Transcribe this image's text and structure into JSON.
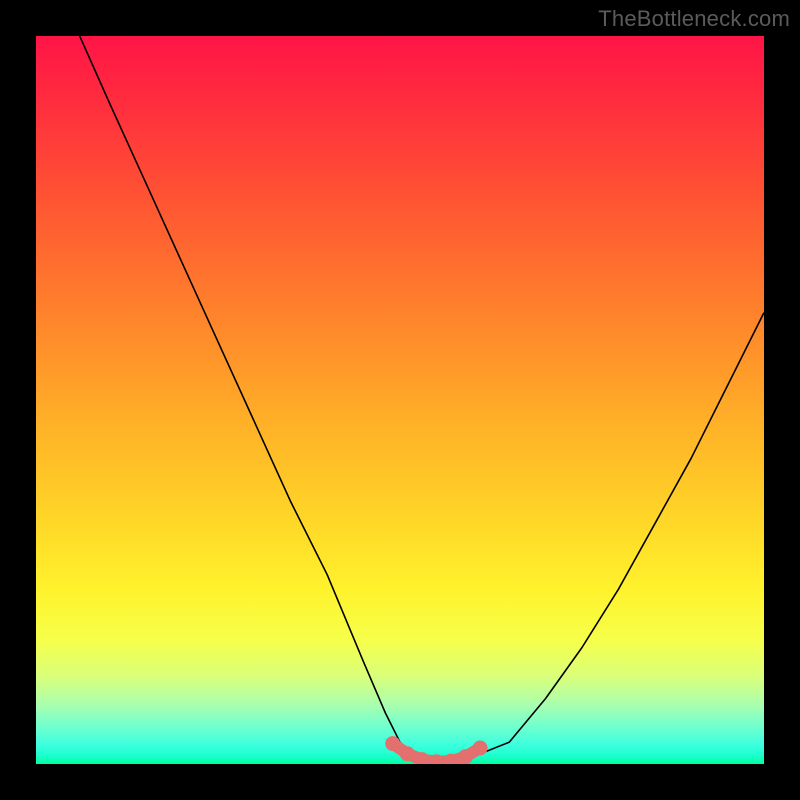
{
  "watermark": "TheBottleneck.com",
  "chart_data": {
    "type": "line",
    "title": "",
    "xlabel": "",
    "ylabel": "",
    "xlim": [
      0,
      100
    ],
    "ylim": [
      0,
      100
    ],
    "grid": false,
    "legend": false,
    "background": "rainbow-gradient-vertical",
    "series": [
      {
        "name": "bottleneck-curve",
        "x": [
          6,
          10,
          15,
          20,
          25,
          30,
          35,
          40,
          45,
          48,
          50,
          52,
          54,
          56,
          58,
          60,
          65,
          70,
          75,
          80,
          85,
          90,
          95,
          100
        ],
        "y": [
          100,
          91,
          80,
          69,
          58,
          47,
          36,
          26,
          14,
          7,
          3,
          1,
          0,
          0,
          0,
          1,
          3,
          9,
          16,
          24,
          33,
          42,
          52,
          62
        ]
      }
    ],
    "highlight_segment": {
      "name": "optimal-range",
      "x": [
        49,
        51,
        53,
        55,
        57,
        59,
        61
      ],
      "y": [
        2.8,
        1.4,
        0.6,
        0.3,
        0.4,
        1.0,
        2.2
      ],
      "color": "#e46f6f"
    }
  }
}
